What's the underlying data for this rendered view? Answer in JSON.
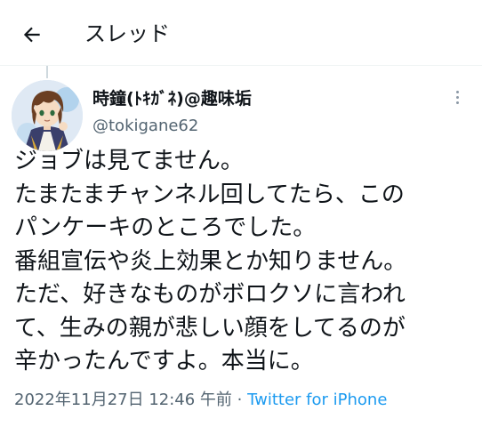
{
  "header": {
    "title": "スレッド",
    "back_icon": "arrow-left-icon"
  },
  "tweet": {
    "display_name": "時鐘(ﾄｷｶﾞﾈ)@趣味垢",
    "handle": "@tokigane62",
    "more_icon": "more-vertical-icon",
    "lines": [
      "ジョブは見てません。",
      "たまたまチャンネル回してたら、この",
      "パンケーキのところでした。",
      "番組宣伝や炎上効果とか知りません。",
      "ただ、好きなものがボロクソに言われ",
      "て、生みの親が悲しい顔をしてるのが",
      "辛かったんですよ。本当に。"
    ],
    "timestamp": "2022年11月27日 12:46 午前",
    "separator": " · ",
    "source": "Twitter for iPhone"
  },
  "colors": {
    "text": "#0f1419",
    "secondary": "#536471",
    "link": "#1d9bf0",
    "border": "#eff3f4"
  }
}
